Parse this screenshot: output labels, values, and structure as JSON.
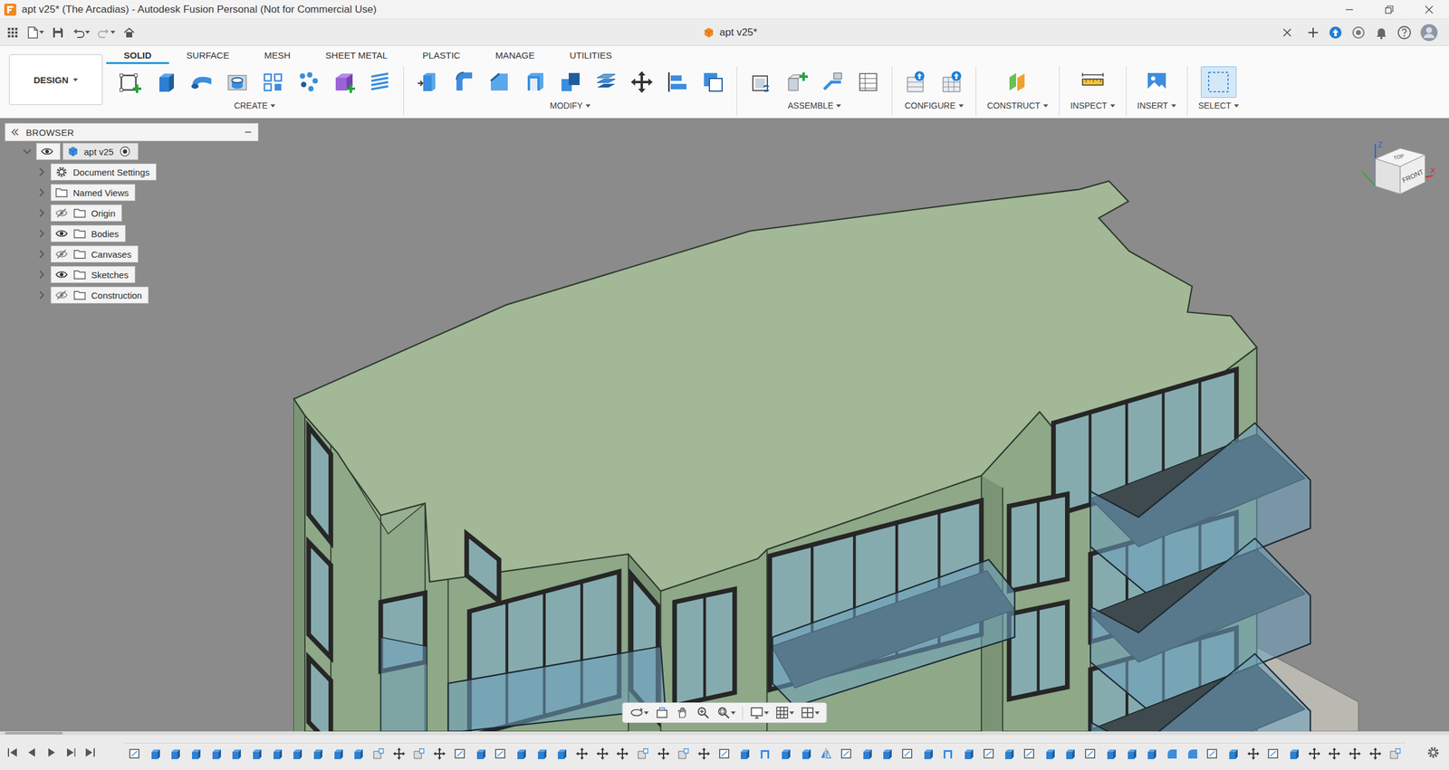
{
  "window": {
    "title": "apt v25* (The Arcadias) - Autodesk Fusion Personal (Not for Commercial Use)"
  },
  "document_tab": {
    "title": "apt v25*"
  },
  "workspace": {
    "label": "DESIGN"
  },
  "ribbon": {
    "tabs": [
      {
        "label": "SOLID",
        "selected": true
      },
      {
        "label": "SURFACE",
        "selected": false
      },
      {
        "label": "MESH",
        "selected": false
      },
      {
        "label": "SHEET METAL",
        "selected": false
      },
      {
        "label": "PLASTIC",
        "selected": false
      },
      {
        "label": "MANAGE",
        "selected": false
      },
      {
        "label": "UTILITIES",
        "selected": false
      }
    ],
    "groups": [
      {
        "label": "CREATE",
        "highlighted": false
      },
      {
        "label": "MODIFY",
        "highlighted": false
      },
      {
        "label": "ASSEMBLE",
        "highlighted": false
      },
      {
        "label": "CONFIGURE",
        "highlighted": false
      },
      {
        "label": "CONSTRUCT",
        "highlighted": false
      },
      {
        "label": "INSPECT",
        "highlighted": false
      },
      {
        "label": "INSERT",
        "highlighted": false
      },
      {
        "label": "SELECT",
        "highlighted": true
      }
    ]
  },
  "browser": {
    "title": "BROWSER",
    "root": {
      "label": "apt v25",
      "expanded": true,
      "visible": true
    },
    "items": [
      {
        "label": "Document Settings",
        "kind": "settings",
        "expanded": false
      },
      {
        "label": "Named Views",
        "kind": "views",
        "expanded": false
      },
      {
        "label": "Origin",
        "kind": "folder",
        "expanded": false,
        "visible": false
      },
      {
        "label": "Bodies",
        "kind": "folder",
        "expanded": false,
        "visible": true
      },
      {
        "label": "Canvases",
        "kind": "folder",
        "expanded": false,
        "visible": false
      },
      {
        "label": "Sketches",
        "kind": "folder",
        "expanded": false,
        "visible": true
      },
      {
        "label": "Construction",
        "kind": "folder",
        "expanded": false,
        "visible": false
      }
    ]
  },
  "view_cube": {
    "front": "FRONT",
    "top": "TOP",
    "z": "Z",
    "x": "X"
  },
  "timeline": {
    "features": [
      {
        "kind": "sketch"
      },
      {
        "kind": "extrude"
      },
      {
        "kind": "extrude"
      },
      {
        "kind": "extrude"
      },
      {
        "kind": "extrude"
      },
      {
        "kind": "extrude"
      },
      {
        "kind": "extrude"
      },
      {
        "kind": "extrude"
      },
      {
        "kind": "extrude"
      },
      {
        "kind": "extrude"
      },
      {
        "kind": "extrude"
      },
      {
        "kind": "extrude"
      },
      {
        "kind": "component"
      },
      {
        "kind": "move"
      },
      {
        "kind": "component"
      },
      {
        "kind": "move"
      },
      {
        "kind": "sketch"
      },
      {
        "kind": "extrude"
      },
      {
        "kind": "sketch"
      },
      {
        "kind": "extrude"
      },
      {
        "kind": "extrude"
      },
      {
        "kind": "extrude"
      },
      {
        "kind": "move"
      },
      {
        "kind": "move"
      },
      {
        "kind": "move"
      },
      {
        "kind": "component"
      },
      {
        "kind": "move"
      },
      {
        "kind": "component"
      },
      {
        "kind": "move"
      },
      {
        "kind": "sketch"
      },
      {
        "kind": "extrude"
      },
      {
        "kind": "shell"
      },
      {
        "kind": "extrude"
      },
      {
        "kind": "extrude"
      },
      {
        "kind": "mirror"
      },
      {
        "kind": "sketch"
      },
      {
        "kind": "extrude"
      },
      {
        "kind": "extrude"
      },
      {
        "kind": "sketch"
      },
      {
        "kind": "extrude"
      },
      {
        "kind": "shell"
      },
      {
        "kind": "extrude"
      },
      {
        "kind": "sketch"
      },
      {
        "kind": "extrude"
      },
      {
        "kind": "sketch"
      },
      {
        "kind": "extrude"
      },
      {
        "kind": "extrude"
      },
      {
        "kind": "sketch"
      },
      {
        "kind": "extrude"
      },
      {
        "kind": "extrude"
      },
      {
        "kind": "extrude"
      },
      {
        "kind": "fillet"
      },
      {
        "kind": "fillet"
      },
      {
        "kind": "sketch"
      },
      {
        "kind": "extrude"
      },
      {
        "kind": "move"
      },
      {
        "kind": "sketch"
      },
      {
        "kind": "extrude"
      },
      {
        "kind": "move"
      },
      {
        "kind": "move"
      },
      {
        "kind": "move"
      },
      {
        "kind": "move"
      },
      {
        "kind": "component"
      }
    ]
  }
}
